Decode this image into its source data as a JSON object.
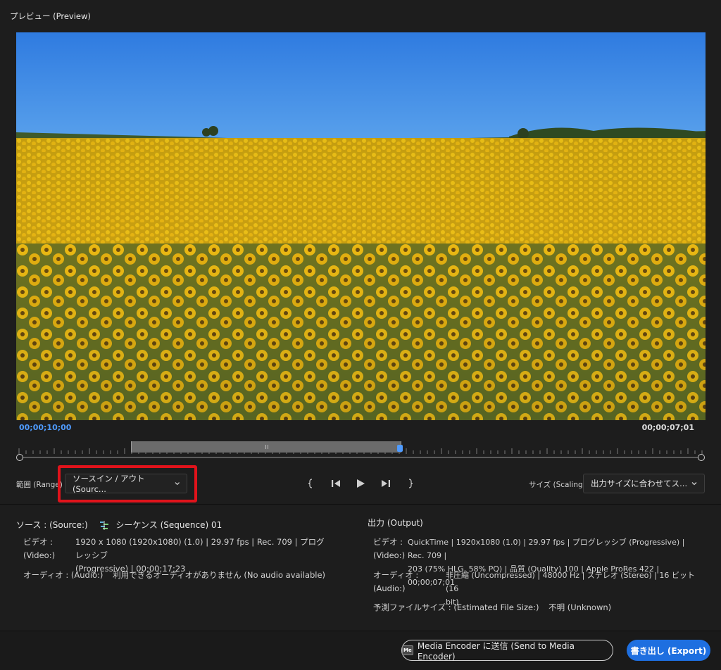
{
  "panel": {
    "title": "プレビュー (Preview)"
  },
  "timeline": {
    "current_timecode": "00;00;10;00",
    "duration_timecode": "00;00;07;01"
  },
  "controls": {
    "range_label": "範囲 (Range)",
    "range_value": "ソースイン / アウト (Sourc...",
    "size_label": "サイズ (Scaling)",
    "size_value": "出力サイズに合わせてス..."
  },
  "source": {
    "heading": "ソース : (Source:)",
    "sequence_name": "シーケンス (Sequence) 01",
    "video_label_1": "ビデオ :",
    "video_label_2": "(Video:)",
    "video_line_1": "1920 x 1080 (1920x1080) (1.0) | 29.97 fps | Rec. 709 | プログレッシブ",
    "video_line_2": "(Progressive) | 00;00;17;23",
    "audio_label": "オーディオ : (Audio:)",
    "audio_value": "利用できるオーディオがありません (No audio available)"
  },
  "output": {
    "heading": "出力 (Output)",
    "video_label_1": "ビデオ :",
    "video_label_2": "(Video:)",
    "video_line_1": "QuickTime | 1920x1080 (1.0) | 29.97 fps | プログレッシブ (Progressive) | Rec. 709 |",
    "video_line_2": "203 (75% HLG, 58% PQ) | 品質 (Quality) 100 | Apple ProRes 422 | 00;00;07;01",
    "audio_label": "オーディオ : (Audio:)",
    "audio_line_1": "非圧縮 (Uncompressed) | 48000 Hz | ステレオ (Stereo) | 16 ビット (16",
    "audio_line_2": "bit)",
    "filesize_label": "予測ファイルサイズ : (Estimated File Size:)",
    "filesize_value": "不明 (Unknown)"
  },
  "footer": {
    "me_badge": "Me",
    "send_label": "Media Encoder に送信 (Send to Media Encoder)",
    "export_label": "書き出し (Export)"
  }
}
